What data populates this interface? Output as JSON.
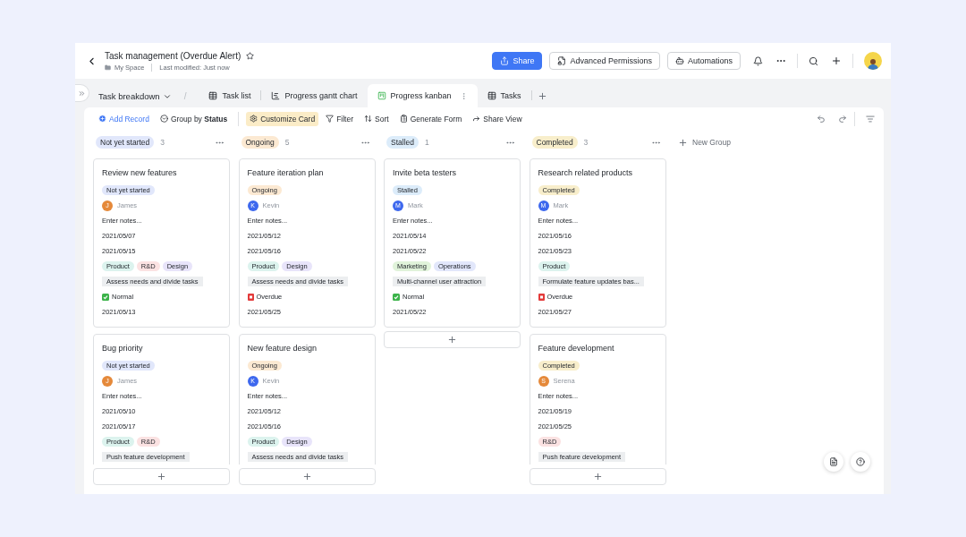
{
  "header": {
    "title": "Task management (Overdue Alert)",
    "location": "My Space",
    "modified": "Last modified: Just now"
  },
  "header_buttons": [
    {
      "label": "Share",
      "kind": "primary"
    },
    {
      "label": "Advanced Permissions",
      "kind": "permissions"
    },
    {
      "label": "Automations",
      "kind": "automations"
    }
  ],
  "breadcrumb": "Task breakdown",
  "separator": "/",
  "tabs": [
    {
      "label": "Task list",
      "kind": "grid",
      "selected": false
    },
    {
      "label": "Progress gantt chart",
      "kind": "gantt",
      "selected": false
    },
    {
      "label": "Progress kanban",
      "kind": "kanban",
      "selected": true
    },
    {
      "label": "Tasks",
      "kind": "grid",
      "selected": false
    }
  ],
  "toolbar": [
    {
      "label": "Add Record",
      "kind": "add",
      "active": false
    },
    {
      "label": "Group by **Status**",
      "kind": "group",
      "active": false
    },
    {
      "label": "Customize Card",
      "kind": "customize",
      "active": true
    },
    {
      "label": "Filter",
      "kind": "filter",
      "active": false
    },
    {
      "label": "Sort",
      "kind": "sort",
      "active": false
    },
    {
      "label": "Generate Form",
      "kind": "form",
      "active": false
    },
    {
      "label": "Share View",
      "kind": "share",
      "active": false
    }
  ],
  "groups": [
    {
      "name": "Not yet started",
      "count": "3",
      "color": "#e1e7fb",
      "cards": [
        {
          "title": "Review new features",
          "status": "Not yet started",
          "assignee": {
            "initial": "J",
            "name": "James",
            "color": "#e5893a"
          },
          "notes": "Enter notes...",
          "start": "2021/05/07",
          "end": "2021/05/15",
          "tags": [
            {
              "label": "Product",
              "color": "#dcf3ee"
            },
            {
              "label": "R&D",
              "color": "#fbe2e2"
            },
            {
              "label": "Design",
              "color": "#e8e4fa"
            }
          ],
          "goal": "Assess needs and divide tasks",
          "priority": {
            "kind": "normal",
            "label": "Normal"
          },
          "due": "2021/05/13"
        },
        {
          "title": "Bug priority",
          "status": "Not yet started",
          "assignee": {
            "initial": "J",
            "name": "James",
            "color": "#e5893a"
          },
          "notes": "Enter notes...",
          "start": "2021/05/10",
          "end": "2021/05/17",
          "tags": [
            {
              "label": "Product",
              "color": "#dcf3ee"
            },
            {
              "label": "R&D",
              "color": "#fbe2e2"
            }
          ],
          "goal": "Push feature development"
        }
      ]
    },
    {
      "name": "Ongoing",
      "count": "5",
      "color": "#fce9d2",
      "cards": [
        {
          "title": "Feature iteration plan",
          "status": "Ongoing",
          "assignee": {
            "initial": "K",
            "name": "Kevin",
            "color": "#3d68ee"
          },
          "notes": "Enter notes...",
          "start": "2021/05/12",
          "end": "2021/05/16",
          "tags": [
            {
              "label": "Product",
              "color": "#dcf3ee"
            },
            {
              "label": "Design",
              "color": "#e8e4fa"
            }
          ],
          "goal": "Assess needs and divide tasks",
          "priority": {
            "kind": "overdue",
            "label": "Overdue"
          },
          "due": "2021/05/25"
        },
        {
          "title": "New feature design",
          "status": "Ongoing",
          "assignee": {
            "initial": "K",
            "name": "Kevin",
            "color": "#3d68ee"
          },
          "notes": "Enter notes...",
          "start": "2021/05/12",
          "end": "2021/05/16",
          "tags": [
            {
              "label": "Product",
              "color": "#dcf3ee"
            },
            {
              "label": "Design",
              "color": "#e8e4fa"
            }
          ],
          "goal": "Assess needs and divide tasks"
        }
      ]
    },
    {
      "name": "Stalled",
      "count": "1",
      "color": "#dcecfa",
      "cards": [
        {
          "title": "Invite beta testers",
          "status": "Stalled",
          "assignee": {
            "initial": "M",
            "name": "Mark",
            "color": "#3d68ee"
          },
          "notes": "Enter notes...",
          "start": "2021/05/14",
          "end": "2021/05/22",
          "tags": [
            {
              "label": "Marketing",
              "color": "#e0f3da"
            },
            {
              "label": "Operations",
              "color": "#e2e7fb"
            }
          ],
          "goal": "Multi-channel user attraction",
          "priority": {
            "kind": "normal",
            "label": "Normal"
          },
          "due": "2021/05/22"
        }
      ]
    },
    {
      "name": "Completed",
      "count": "3",
      "color": "#f8eecb",
      "cards": [
        {
          "title": "Research related products",
          "status": "Completed",
          "assignee": {
            "initial": "M",
            "name": "Mark",
            "color": "#3d68ee"
          },
          "notes": "Enter notes...",
          "start": "2021/05/16",
          "end": "2021/05/23",
          "tags": [
            {
              "label": "Product",
              "color": "#dcf3ee"
            }
          ],
          "goal": "Formulate feature updates bas...",
          "priority": {
            "kind": "overdue",
            "label": "Overdue"
          },
          "due": "2021/05/27"
        },
        {
          "title": "Feature development",
          "status": "Completed",
          "assignee": {
            "initial": "S",
            "name": "Serena",
            "color": "#e5893a"
          },
          "notes": "Enter notes...",
          "start": "2021/05/19",
          "end": "2021/05/25",
          "tags": [
            {
              "label": "R&D",
              "color": "#fbe2e2"
            }
          ],
          "goal": "Push feature development"
        }
      ]
    }
  ],
  "new_group": "New Group"
}
